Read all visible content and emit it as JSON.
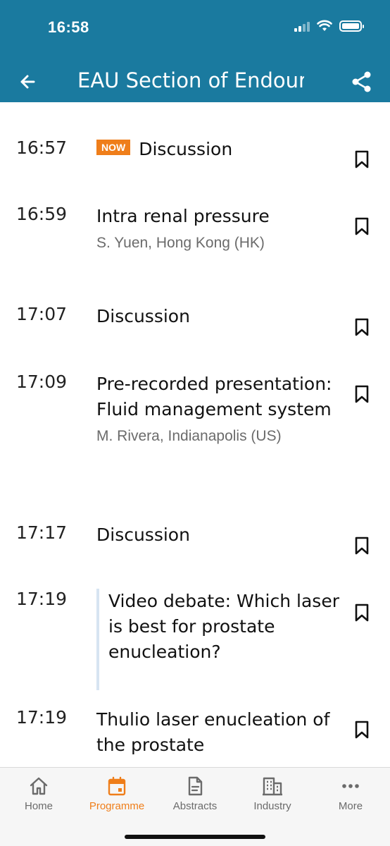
{
  "status_bar": {
    "time": "16:58"
  },
  "header": {
    "title": "EAU Section of Endourology"
  },
  "sessions": [
    {
      "time": "16:57",
      "badge": "NOW",
      "title": "Discussion",
      "speaker": ""
    },
    {
      "time": "16:59",
      "title": "Intra renal pressure",
      "speaker": "S. Yuen, Hong Kong (HK)"
    },
    {
      "time": "17:07",
      "title": "Discussion",
      "speaker": ""
    },
    {
      "time": "17:09",
      "title": "Pre-recorded presentation: Fluid management system",
      "speaker": "M. Rivera, Indianapolis (US)"
    },
    {
      "time": "17:17",
      "title": "Discussion",
      "speaker": ""
    },
    {
      "time": "17:19",
      "title": "Video debate: Which laser is best for prostate enucleation?",
      "speaker": ""
    },
    {
      "time": "17:19",
      "title": "Thulio laser enucleation of the prostate",
      "speaker": ""
    }
  ],
  "tabs": [
    {
      "label": "Home",
      "icon": "home-icon"
    },
    {
      "label": "Programme",
      "icon": "calendar-icon",
      "active": true
    },
    {
      "label": "Abstracts",
      "icon": "document-icon"
    },
    {
      "label": "Industry",
      "icon": "building-icon"
    },
    {
      "label": "More",
      "icon": "more-icon"
    }
  ],
  "colors": {
    "header": "#1a7a9f",
    "accent": "#ef7e1a",
    "speaker": "#6b6b6b",
    "indent_bar": "#d7e4f2"
  }
}
